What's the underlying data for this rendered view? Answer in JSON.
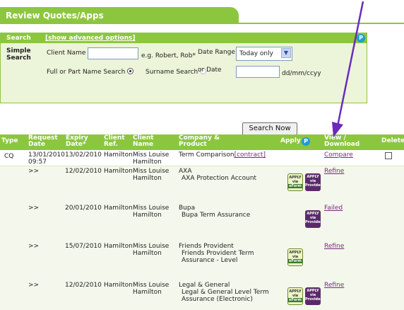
{
  "tab": {
    "title": "Review Quotes/Apps"
  },
  "search": {
    "header": "Search",
    "advanced_link": "[show advanced options]",
    "simple_label": "Simple Search",
    "client_name_label": "Client Name",
    "client_name_value": "",
    "client_name_hint": "e.g. Robert, Rob*",
    "date_range_label": "Date Range",
    "date_range_value": "Today only",
    "full_or_part_label": "Full or Part Name Search",
    "surname_label": "Surname Search",
    "or_date_label": "or Date",
    "date_value": "",
    "date_format": "dd/mm/ccyy",
    "search_button": "Search Now"
  },
  "grid": {
    "headers": {
      "type": "Type",
      "request_date": "Request Date",
      "expiry_date": "Expiry Date*",
      "client_ref": "Client Ref.",
      "client_name": "Client Name",
      "company_product": "Company & Product",
      "apply": "Apply",
      "view_download": "View / Download",
      "delete": "Delete"
    },
    "rows": [
      {
        "type": "CQ",
        "request_date": "13/01/2010",
        "request_time": "09:57",
        "expiry": "13/02/2010",
        "ref": "Hamilton",
        "name": "Miss Louise Hamilton",
        "company": "Term Comparison",
        "company_link": "[contract]",
        "product": "",
        "action": "Compare"
      },
      {
        "type": ">>",
        "request_date": "",
        "expiry": "12/02/2010",
        "ref": "Hamilton",
        "name": "Miss Louise Hamilton",
        "company": "AXA",
        "product": "AXA Protection Account",
        "action": "Refine"
      },
      {
        "type": ">>",
        "request_date": "",
        "expiry": "20/01/2010",
        "ref": "Hamilton",
        "name": "Miss Louise Hamilton",
        "company": "Bupa",
        "product": "Bupa Term Assurance",
        "action": "Failed"
      },
      {
        "type": ">>",
        "request_date": "",
        "expiry": "15/07/2010",
        "ref": "Hamilton",
        "name": "Miss Louise Hamilton",
        "company": "Friends Provident",
        "product": "Friends Provident Term Assurance - Level",
        "action": "Refine"
      },
      {
        "type": ">>",
        "request_date": "",
        "expiry": "12/02/2010",
        "ref": "Hamilton",
        "name": "Miss Louise Hamilton",
        "company": "Legal & General",
        "product": "Legal & General Level Term Assurance (Electronic)",
        "action": "Refine"
      }
    ],
    "apply_badges": {
      "eform": {
        "line1": "APPLY",
        "line2": "via",
        "line3": "eForm"
      },
      "provider": {
        "line1": "APPLY",
        "line2": "via",
        "line3": "Provider"
      }
    }
  },
  "help_glyph": "P",
  "colors": {
    "brand_green": "#8cc63f",
    "panel_bg": "#ecf4da",
    "link_purple": "#7a2a7a",
    "annotation_arrow": "#6a2bbd",
    "help_blue": "#1a9ed8"
  }
}
